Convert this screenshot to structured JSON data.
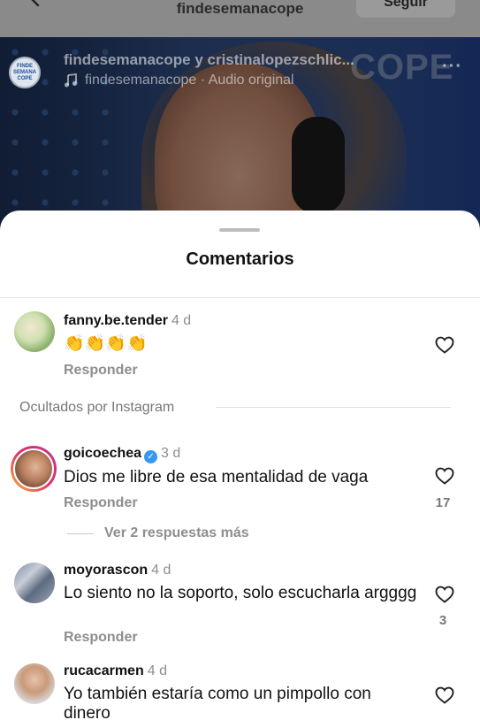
{
  "header": {
    "account": "findesemanacope",
    "follow_label": "Seguir"
  },
  "post": {
    "users": "findesemanacope y cristinalopezschlic...",
    "audio": "findesemanacope · Audio original",
    "brand_overlay": "COPE",
    "avatar_text": "FINDE SEMANA COPE"
  },
  "comments_sheet": {
    "title": "Comentarios",
    "hidden_label": "Ocultados por Instagram",
    "comments": [
      {
        "user": "fanny.be.tender",
        "time": "4 d",
        "text": "👏👏👏👏",
        "reply": "Responder",
        "likes": ""
      },
      {
        "user": "goicoechea",
        "time": "3 d",
        "verified": true,
        "text": "Dios me libre de esa mentalidad de vaga",
        "reply": "Responder",
        "likes": "17",
        "more_replies": "Ver 2 respuestas más"
      },
      {
        "user": "moyorascon",
        "time": "4 d",
        "text": "Lo siento no la soporto, solo escucharla argggg",
        "reply": "Responder",
        "likes": "3"
      },
      {
        "user": "rucacarmen",
        "time": "4 d",
        "text": "Yo también estaría como un pimpollo con dinero",
        "reply": "",
        "likes": ""
      }
    ]
  },
  "colors": {
    "link_gray": "#8e8e8e",
    "verified_blue": "#3897f0",
    "story_ring": "#e1306c"
  }
}
